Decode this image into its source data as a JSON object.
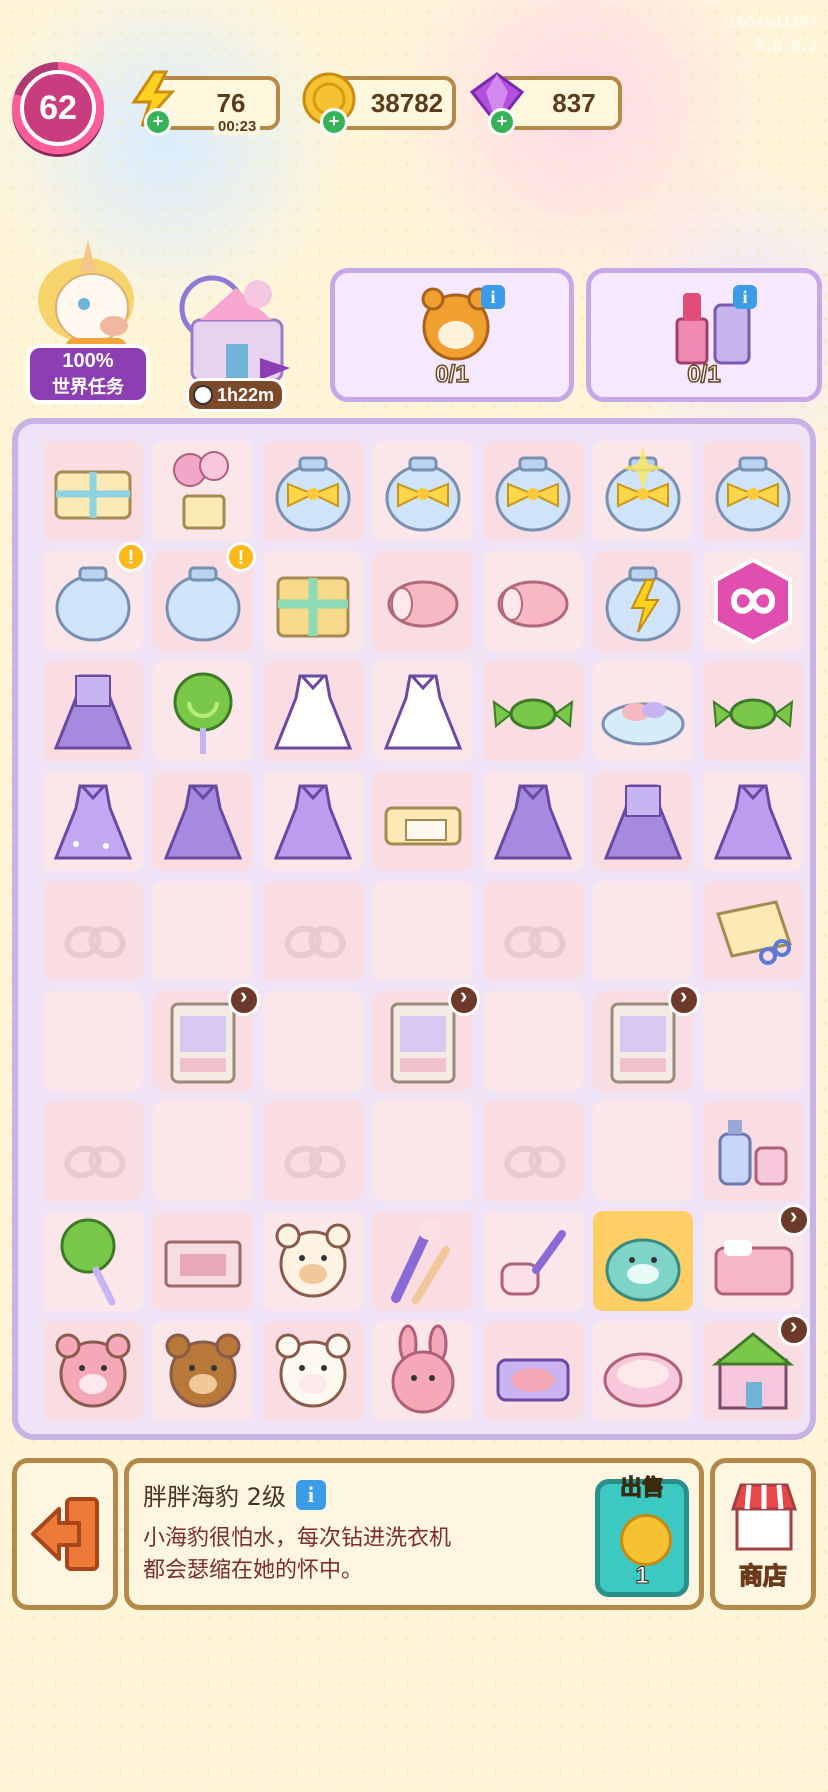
{
  "header": {
    "player_level": "62",
    "energy": {
      "value": "76",
      "timer": "00:23"
    },
    "coins": {
      "value": "38782"
    },
    "gems": {
      "value": "837"
    },
    "id_text": [
      "100404138?",
      "0.0.0.2"
    ]
  },
  "world_task": {
    "percent": "100%",
    "label": "世界任务"
  },
  "building": {
    "timer": "1h22m"
  },
  "orders": [
    {
      "item": "bear-in-costume",
      "progress": "0/1"
    },
    {
      "item": "cosmetics-set",
      "progress": "0/1"
    }
  ],
  "board": {
    "rows": [
      [
        "gift-box-ribbon",
        "balloons-gift",
        "glass-jar-bow",
        "glass-jar-bow",
        "glass-jar-bow",
        "glass-jar-bow-sparkle",
        "glass-jar-bow"
      ],
      [
        "empty-glass-jar-alert",
        "empty-glass-jar-alert",
        "green-gift-box",
        "pink-cake-roll",
        "pink-cake-roll",
        "energy-jar-sparkle",
        "infinity-token"
      ],
      [
        "purple-cardigan-dress",
        "green-lollipop",
        "white-lace-dress",
        "white-lace-dress",
        "green-candy",
        "candy-plate",
        "green-candy"
      ],
      [
        "purple-ball-gown",
        "purple-collar-dress",
        "purple-slip-dress",
        "fabric-bundle",
        "purple-collar-dress",
        "purple-cardigan-dress",
        "purple-slip-dress"
      ],
      [
        "locked",
        "empty",
        "locked",
        "empty",
        "locked",
        "empty",
        "fabric-scissors"
      ],
      [
        "empty",
        "wardrobe-timer",
        "empty",
        "wardrobe-timer",
        "empty",
        "wardrobe-timer",
        "empty"
      ],
      [
        "locked",
        "empty",
        "locked",
        "empty",
        "locked",
        "empty",
        "perfume-set"
      ],
      [
        "green-lollipop-stick",
        "pink-drawer",
        "puppy-plush",
        "makeup-brushes",
        "lint-roller",
        "chubby-seal-selected",
        "pink-bed-timer"
      ],
      [
        "pink-bear-plush",
        "brown-bear-plush",
        "sheep-plush",
        "bunny-plush",
        "compact-blush",
        "powder-tin",
        "shop-building-timer"
      ]
    ]
  },
  "selected_item": {
    "name": "胖胖海豹 2级",
    "desc": [
      "小海豹很怕水，每次钻进洗衣机",
      "都会瑟缩在她的怀中。"
    ],
    "sell_label": "出售",
    "sell_price": "1"
  },
  "shop": {
    "label": "商店"
  },
  "colors": {
    "accent_pink": "#c93d7f",
    "panel_border": "#b5894a",
    "board_border": "#c9b3e6",
    "sell_teal": "#3bc9c2"
  }
}
